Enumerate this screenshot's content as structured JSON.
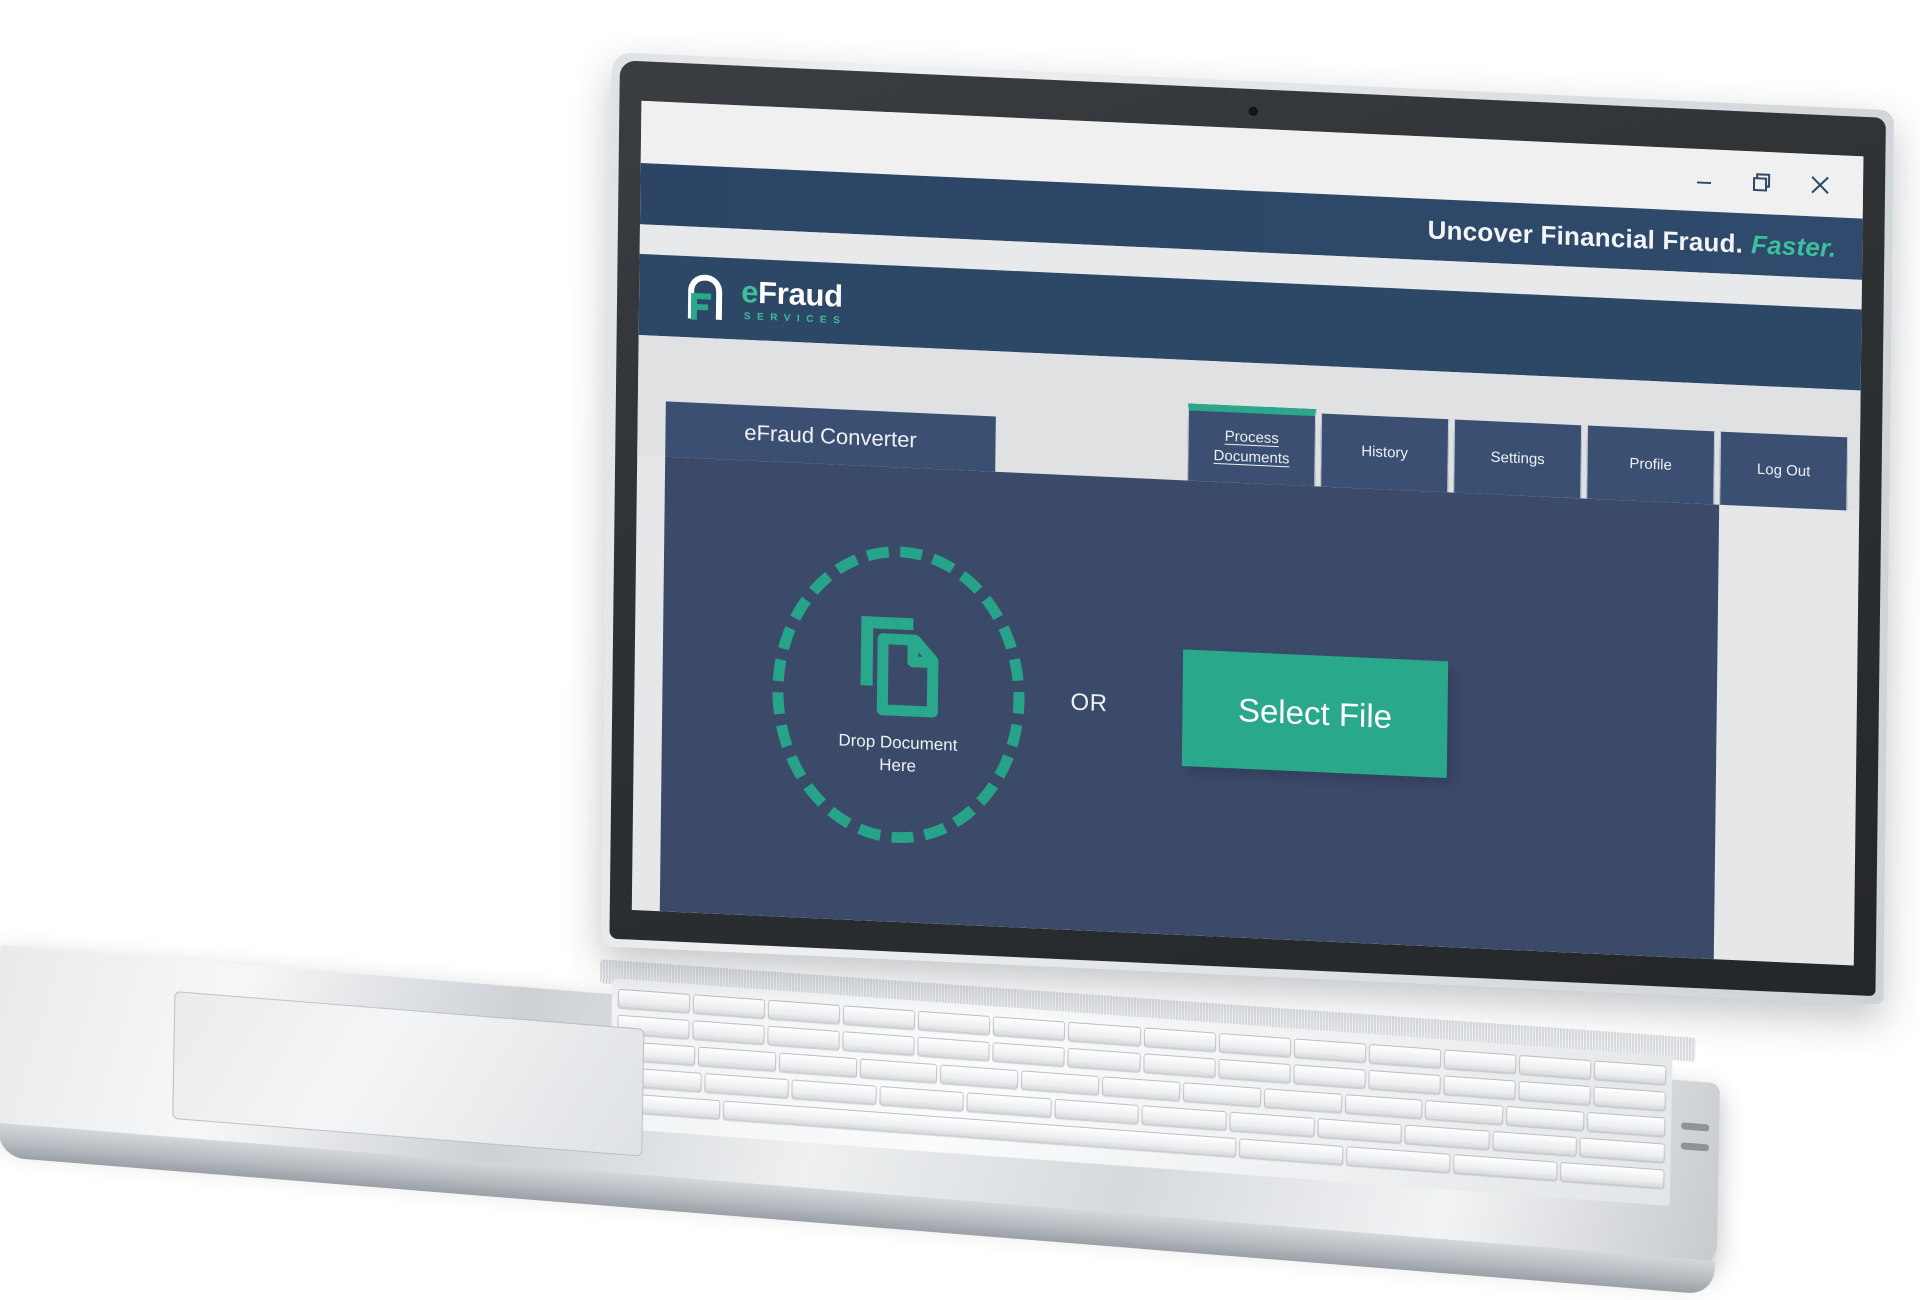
{
  "window_controls": [
    {
      "name": "minimize",
      "icon": "minimize-icon"
    },
    {
      "name": "restore",
      "icon": "restore-icon"
    },
    {
      "name": "close",
      "icon": "close-icon"
    }
  ],
  "tagline": {
    "main": "Uncover Financial Fraud.",
    "accent": "Faster."
  },
  "logo": {
    "prefix": "e",
    "word": "Fraud",
    "subtitle": "SERVICES"
  },
  "app": {
    "title": "eFraud Converter"
  },
  "tabs": [
    {
      "label": "Process\nDocuments",
      "line1": "Process",
      "line2": "Documents",
      "active": true
    },
    {
      "label": "History",
      "line1": "History",
      "line2": "",
      "active": false
    },
    {
      "label": "Settings",
      "line1": "Settings",
      "line2": "",
      "active": false
    },
    {
      "label": "Profile",
      "line1": "Profile",
      "line2": "",
      "active": false
    },
    {
      "label": "Log Out",
      "line1": "Log Out",
      "line2": "",
      "active": false
    }
  ],
  "dropzone": {
    "label_line1": "Drop Document",
    "label_line2": "Here",
    "icon": "copy-documents-icon"
  },
  "separator": {
    "text": "OR"
  },
  "select_file": {
    "label": "Select File"
  },
  "colors": {
    "navy_header": "#2d4767",
    "navy_panel": "#3c4a6a",
    "navy_tab": "#3a4f71",
    "teal": "#2aa88c",
    "teal_light": "#3cbf9b",
    "screen_bg": "#e8e9ea",
    "chrome_bg": "#f0f0f0"
  }
}
